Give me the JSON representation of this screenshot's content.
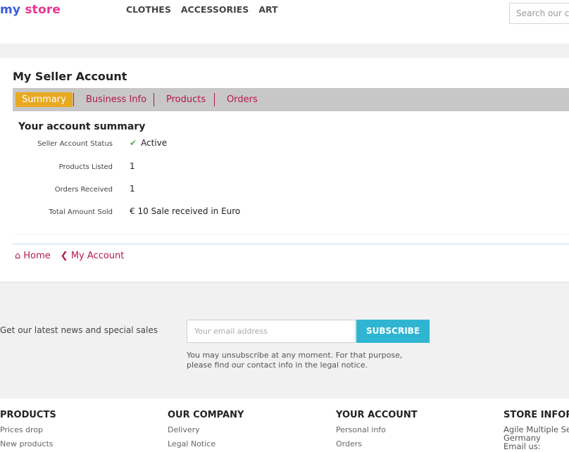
{
  "header": {
    "logo_part1": "my",
    "logo_part2": "store",
    "nav": [
      "CLOTHES",
      "ACCESSORIES",
      "ART"
    ],
    "search_placeholder": "Search our catalog"
  },
  "account": {
    "title": "My Seller Account",
    "tabs": [
      "Summary",
      "Business Info",
      "Products",
      "Orders"
    ],
    "active_tab": "Summary",
    "summary_title": "Your account summary",
    "rows": [
      {
        "label": "Seller Account Status",
        "value": "Active"
      },
      {
        "label": "Products Listed",
        "value": "1"
      },
      {
        "label": "Orders Received",
        "value": "1"
      },
      {
        "label": "Total Amount Sold",
        "value": "€ 10 Sale received in Euro"
      }
    ],
    "links": {
      "home": "Home",
      "my_account": "My Account"
    }
  },
  "newsletter": {
    "text": "Get our latest news and special sales",
    "placeholder": "Your email address",
    "button": "SUBSCRIBE",
    "note": "You may unsubscribe at any moment. For that purpose, please find our contact info in the legal notice."
  },
  "footer": {
    "products": {
      "title": "PRODUCTS",
      "links": [
        "Prices drop",
        "New products"
      ]
    },
    "company": {
      "title": "OUR COMPANY",
      "links": [
        "Delivery",
        "Legal Notice"
      ]
    },
    "account": {
      "title": "YOUR ACCOUNT",
      "links": [
        "Personal info",
        "Orders"
      ]
    },
    "store": {
      "title": "STORE INFORMATION",
      "lines": [
        "Agile Multiple Seller",
        "Germany",
        "Email us:"
      ]
    }
  },
  "colors": {
    "accent": "#b5174b",
    "active_tab": "#e8a920",
    "subscribe": "#2fb5d2",
    "check": "#4caf50"
  }
}
